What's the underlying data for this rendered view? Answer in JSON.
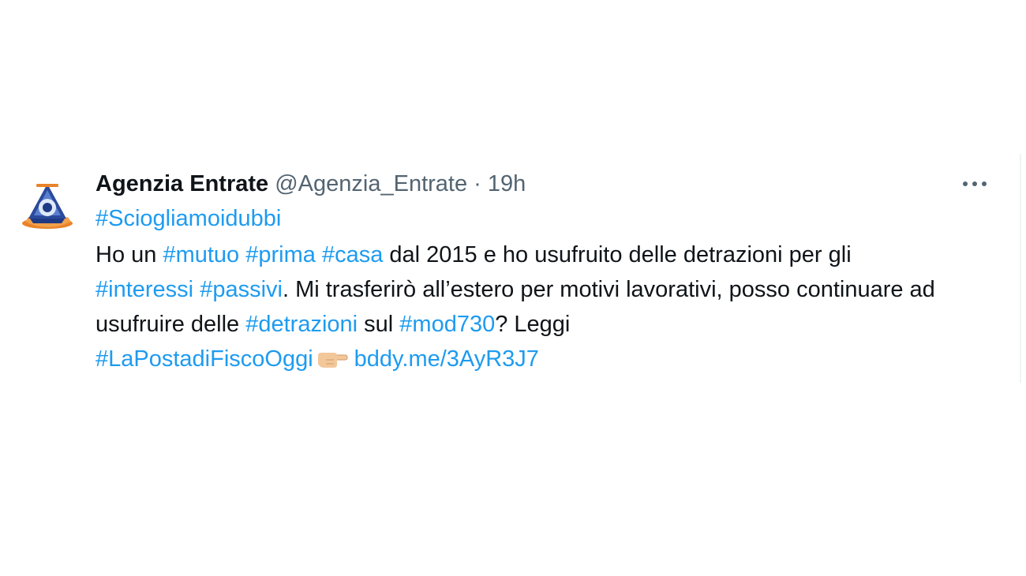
{
  "tweet": {
    "author_name": "Agenzia Entrate",
    "handle": "@Agenzia_Entrate",
    "separator": " · ",
    "time": "19h",
    "more_icon": "more-dots-icon",
    "hashtag_first": "#Sciogliamoidubbi",
    "text": {
      "t1": "Ho un ",
      "h_mutuo": "#mutuo",
      "s1": " ",
      "h_prima": "#prima",
      "s2": " ",
      "h_casa": "#casa",
      "t2": " dal 2015 e ho usufruito delle detrazioni per gli ",
      "h_interessi": "#interessi",
      "s3": " ",
      "h_passivi": "#passivi",
      "t3": ". Mi trasferirò all’estero per motivi lavorativi, posso continuare ad usufruire delle ",
      "h_detrazioni": "#detrazioni",
      "t4": " sul ",
      "h_mod730": "#mod730",
      "t5": "? Leggi ",
      "h_posta": "#LaPostadiFiscoOggi",
      "emoji": "pointing-right-hand-icon",
      "link": "bddy.me/3AyR3J7"
    },
    "colors": {
      "link": "#1d9bf0",
      "text": "#0f1419",
      "meta": "#536471"
    }
  }
}
